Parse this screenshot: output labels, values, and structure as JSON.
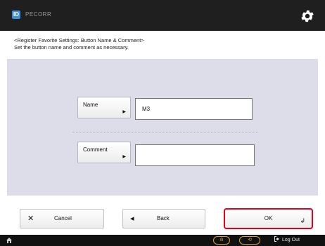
{
  "topbar": {
    "app_icon": "ID",
    "app_name": "PECORR",
    "settings_icon": "gear-icon"
  },
  "header": {
    "line1": "<Register Favorite Settings: Button Name & Comment>",
    "line2": "Set the button name and comment as necessary."
  },
  "form": {
    "name_label": "Name",
    "name_value": "M3",
    "comment_label": "Comment",
    "comment_value": "",
    "field_arrow": "▶"
  },
  "footer": {
    "cancel_label": "Cancel",
    "cancel_icon": "✕",
    "back_label": "Back",
    "back_icon": "◂",
    "ok_label": "OK",
    "ok_icon": "↲"
  },
  "statusbar": {
    "status_monitor_label": "ılı",
    "status_monitor_icon": "status-monitor-icon",
    "energy_saver_label": "⟲",
    "logout_label": "Log Out",
    "colors": {
      "highlight": "#e3001b",
      "status": "#d8a040"
    }
  }
}
